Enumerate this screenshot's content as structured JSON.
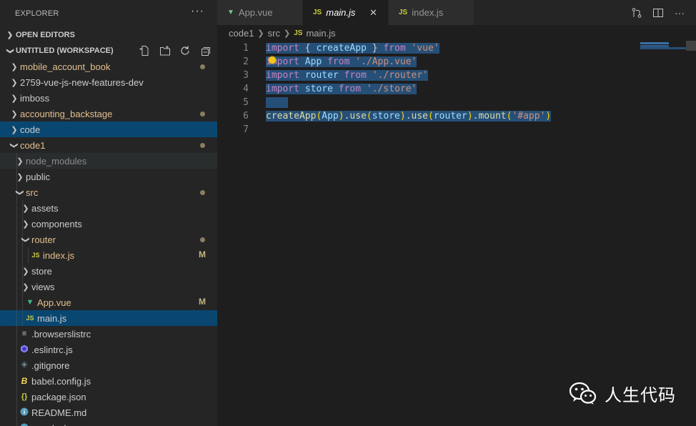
{
  "explorer": {
    "title": "EXPLORER",
    "more": "···",
    "open_editors": "OPEN EDITORS",
    "workspace": "UNTITLED (WORKSPACE)"
  },
  "tree": [
    {
      "label": "mobile_account_book",
      "type": "folder",
      "expanded": false,
      "color": "orange",
      "dot": true
    },
    {
      "label": "2759-vue-js-new-features-dev",
      "type": "folder",
      "expanded": false
    },
    {
      "label": "imboss",
      "type": "folder",
      "expanded": false
    },
    {
      "label": "accounting_backstage",
      "type": "folder",
      "expanded": false,
      "color": "orange",
      "dot": true
    },
    {
      "label": "code",
      "type": "folder",
      "expanded": false,
      "state": "selected"
    },
    {
      "label": "code1",
      "type": "folder",
      "expanded": true,
      "color": "orange",
      "dot": true
    },
    {
      "label": "node_modules",
      "type": "folder",
      "expanded": false,
      "color": "dim",
      "state": "hover"
    },
    {
      "label": "public",
      "type": "folder",
      "expanded": false
    },
    {
      "label": "src",
      "type": "folder",
      "expanded": true,
      "color": "orange",
      "dot": true
    },
    {
      "label": "assets",
      "type": "folder",
      "expanded": false
    },
    {
      "label": "components",
      "type": "folder",
      "expanded": false
    },
    {
      "label": "router",
      "type": "folder",
      "expanded": true,
      "color": "orange",
      "dot": true
    },
    {
      "label": "index.js",
      "type": "js",
      "color": "orange",
      "badge": "M"
    },
    {
      "label": "store",
      "type": "folder",
      "expanded": false
    },
    {
      "label": "views",
      "type": "folder",
      "expanded": false
    },
    {
      "label": "App.vue",
      "type": "vue",
      "color": "orange",
      "badge": "M"
    },
    {
      "label": "main.js",
      "type": "js",
      "state": "selected"
    },
    {
      "label": ".browserslistrc",
      "type": "lines"
    },
    {
      "label": ".eslintrc.js",
      "type": "eslint"
    },
    {
      "label": ".gitignore",
      "type": "git"
    },
    {
      "label": "babel.config.js",
      "type": "babel"
    },
    {
      "label": "package.json",
      "type": "json"
    },
    {
      "label": "README.md",
      "type": "info"
    },
    {
      "label": "yarn.lock",
      "type": "yarn"
    }
  ],
  "tabs": [
    {
      "label": "App.vue",
      "icon": "vue",
      "active": false
    },
    {
      "label": "main.js",
      "icon": "js",
      "active": true
    },
    {
      "label": "index.js",
      "icon": "js",
      "active": false
    }
  ],
  "breadcrumb": {
    "parts": [
      "code1",
      "src"
    ],
    "file": "main.js"
  },
  "code_lines": [
    {
      "num": "1",
      "tokens": [
        [
          "k",
          "import"
        ],
        [
          "p",
          " { "
        ],
        [
          "v",
          "createApp"
        ],
        [
          "p",
          " } "
        ],
        [
          "k",
          "from"
        ],
        [
          "p",
          " "
        ],
        [
          "s",
          "'vue'"
        ]
      ]
    },
    {
      "num": "2",
      "tokens": [
        [
          "k",
          "import"
        ],
        [
          "p",
          " "
        ],
        [
          "v",
          "App"
        ],
        [
          "p",
          " "
        ],
        [
          "k",
          "from"
        ],
        [
          "p",
          " "
        ],
        [
          "s",
          "'./App.vue'"
        ]
      ]
    },
    {
      "num": "3",
      "tokens": [
        [
          "k",
          "import"
        ],
        [
          "p",
          " "
        ],
        [
          "v",
          "router"
        ],
        [
          "p",
          " "
        ],
        [
          "k",
          "from"
        ],
        [
          "p",
          " "
        ],
        [
          "s",
          "'./router'"
        ]
      ]
    },
    {
      "num": "4",
      "tokens": [
        [
          "k",
          "import"
        ],
        [
          "p",
          " "
        ],
        [
          "v",
          "store"
        ],
        [
          "p",
          " "
        ],
        [
          "k",
          "from"
        ],
        [
          "p",
          " "
        ],
        [
          "s",
          "'./store'"
        ]
      ]
    },
    {
      "num": "5",
      "tokens": [
        [
          "p",
          "    "
        ]
      ]
    },
    {
      "num": "6",
      "tokens": [
        [
          "f",
          "createApp"
        ],
        [
          "br",
          "("
        ],
        [
          "v",
          "App"
        ],
        [
          "br",
          ")"
        ],
        [
          "p",
          "."
        ],
        [
          "f",
          "use"
        ],
        [
          "br",
          "("
        ],
        [
          "v",
          "store"
        ],
        [
          "br",
          ")"
        ],
        [
          "p",
          "."
        ],
        [
          "f",
          "use"
        ],
        [
          "br",
          "("
        ],
        [
          "v",
          "router"
        ],
        [
          "br",
          ")"
        ],
        [
          "p",
          "."
        ],
        [
          "f",
          "mount"
        ],
        [
          "br",
          "("
        ],
        [
          "s",
          "'#app'"
        ],
        [
          "br",
          ")"
        ]
      ]
    },
    {
      "num": "7",
      "tokens": []
    }
  ],
  "watermark": "人生代码",
  "colors": {
    "selection": "#264f78",
    "selected_row": "#094771",
    "modified": "#e2c08d"
  }
}
